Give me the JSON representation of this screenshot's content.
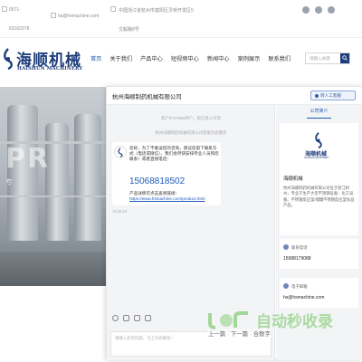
{
  "topbar": {
    "phone_prefix": "0571-",
    "phone_number": "63162278",
    "email": "hs@hsmachine.com",
    "address_line1": "中国浙江省杭州市富阳区灵桥开发区5",
    "address_line2": "文毅路8号"
  },
  "header": {
    "logo_cn": "海顺机械",
    "logo_en": "HAISHUN MACHINERY"
  },
  "nav": {
    "items": [
      {
        "label": "首页",
        "active": true
      },
      {
        "label": "关于我们"
      },
      {
        "label": "产品中心"
      },
      {
        "label": "短视频中心"
      },
      {
        "label": "新闻中心"
      },
      {
        "label": "案例展示"
      },
      {
        "label": "联系我们"
      }
    ]
  },
  "search": {
    "placeholder": "请输入关键"
  },
  "hero": {
    "big_text": "PR",
    "small_text": "专"
  },
  "chat": {
    "title": "杭州海顺制药机械有限公司",
    "human_btn": "转人工客服",
    "sys_line1": "客户IP:67684用户，您已进入对话",
    "sys_line2": "杭州海顺制药机械有限公司客服为您服务",
    "message": "您好，为了不耽误您的咨询，建议您留下联系方式（电话或微信），我们会尽快安排专业人员和您联系！或者直接电话：",
    "phone": "15068818502",
    "note": "产品详情可点击查阅链接：",
    "link": "https://www.hsmachine.com/product.html",
    "time": "15:46:23",
    "input_placeholder": "请输入您的问题，马上为您解答~"
  },
  "company": {
    "tab": "公司简介",
    "logo_cn": "海顺机械",
    "logo_en": "HAISHUN MACHINERY",
    "name": "海顺机械",
    "desc": "杭州海顺制药机械有限公司位于浙江杭州，专业于生产大型不锈钢设备：化工设备、不锈钢反应釜/储罐不锈钢反应釜标品产品。",
    "contact_label": "联系电话",
    "contact_phone": "15988179088",
    "email_label": "电子邮箱",
    "email": "hs@hsmachine.com"
  },
  "watermark": {
    "text": "自动秒收录",
    "nav": "上一篇 · 下一篇 · 合数字"
  },
  "colors": {
    "brand": "#1d3d7a",
    "link": "#1e5bb8",
    "watermark": "#78c869"
  }
}
